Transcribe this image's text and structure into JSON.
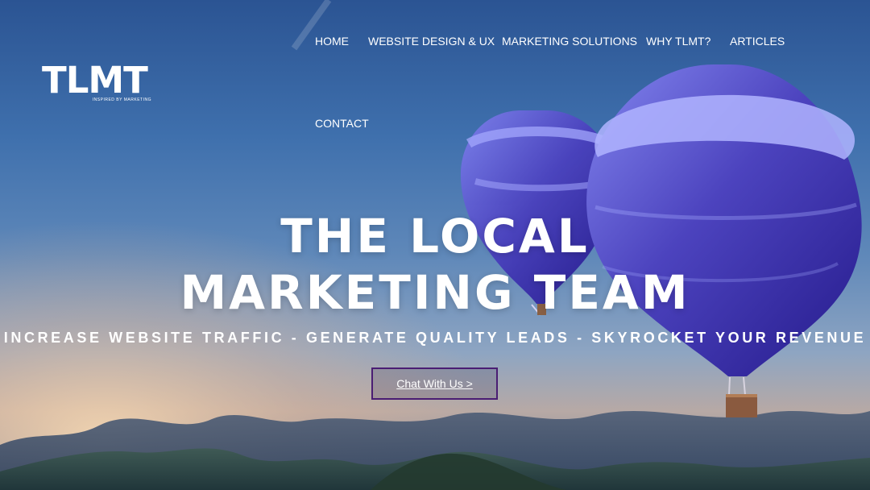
{
  "brand": {
    "logo": "TLMT",
    "tagline": "INSPIRED BY MARKETING"
  },
  "nav": {
    "items": [
      {
        "label": "HOME"
      },
      {
        "label": "WEBSITE DESIGN & UX"
      },
      {
        "label": "MARKETING SOLUTIONS"
      },
      {
        "label": "WHY TLMT?"
      },
      {
        "label": "ARTICLES"
      },
      {
        "label": "CONTACT"
      }
    ]
  },
  "hero": {
    "headline_line_1": "THE LOCAL",
    "headline_line_2": "MARKETING TEAM",
    "subheadline": "INCREASE WEBSITE TRAFFIC - GENERATE QUALITY LEADS - SKYROCKET YOUR REVENUE",
    "cta_label": "Chat With Us >"
  },
  "colors": {
    "accent_border": "#4a1d73",
    "text": "#ffffff",
    "balloon": "#5650c7"
  },
  "icons": {
    "hero_illustration": "hot-air-balloons-mountains"
  }
}
